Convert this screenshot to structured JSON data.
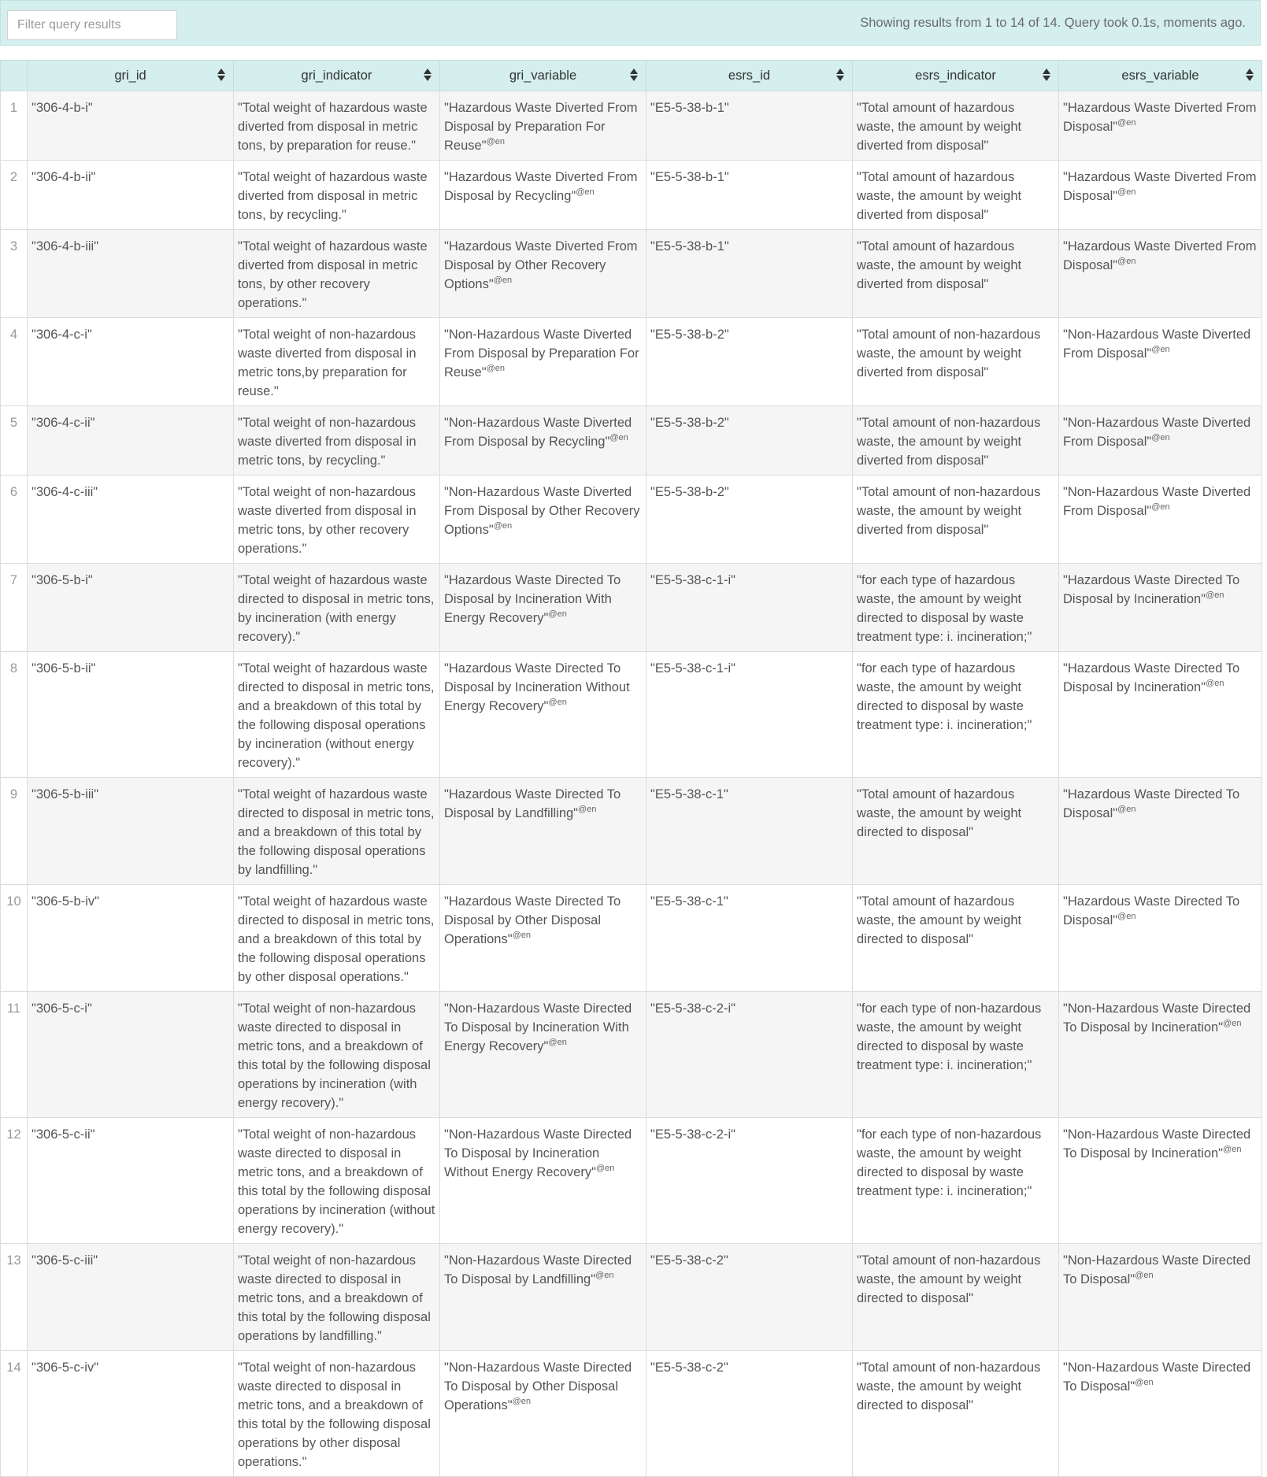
{
  "toolbar": {
    "filter_placeholder": "Filter query results",
    "status": "Showing results from 1 to 14 of 14. Query took 0.1s, moments ago."
  },
  "columns": [
    "gri_id",
    "gri_indicator",
    "gri_variable",
    "esrs_id",
    "esrs_indicator",
    "esrs_variable"
  ],
  "lang_tag": "@en",
  "rows": [
    {
      "n": "1",
      "gri_id": "\"306-4-b-i\"",
      "gri_indicator": "\"Total weight of hazardous waste diverted from disposal in metric tons, by preparation for reuse.\"",
      "gri_variable": "\"Hazardous Waste Diverted From Disposal by Preparation For Reuse\"",
      "esrs_id": "\"E5-5-38-b-1\"",
      "esrs_indicator": "\"Total amount of hazardous waste, the amount by weight diverted from disposal\"",
      "esrs_variable": "\"Hazardous Waste Diverted From Disposal\""
    },
    {
      "n": "2",
      "gri_id": "\"306-4-b-ii\"",
      "gri_indicator": "\"Total weight of hazardous waste diverted from disposal in metric tons, by recycling.\"",
      "gri_variable": "\"Hazardous Waste Diverted From Disposal by Recycling\"",
      "esrs_id": "\"E5-5-38-b-1\"",
      "esrs_indicator": "\"Total amount of hazardous waste, the amount by weight diverted from disposal\"",
      "esrs_variable": "\"Hazardous Waste Diverted From Disposal\""
    },
    {
      "n": "3",
      "gri_id": "\"306-4-b-iii\"",
      "gri_indicator": "\"Total weight of hazardous waste diverted from disposal in metric tons, by other recovery operations.\"",
      "gri_variable": "\"Hazardous Waste Diverted From Disposal by Other Recovery Options\"",
      "esrs_id": "\"E5-5-38-b-1\"",
      "esrs_indicator": "\"Total amount of hazardous waste, the amount by weight diverted from disposal\"",
      "esrs_variable": "\"Hazardous Waste Diverted From Disposal\""
    },
    {
      "n": "4",
      "gri_id": "\"306-4-c-i\"",
      "gri_indicator": "\"Total weight of non-hazardous waste diverted from disposal in metric tons,by preparation for reuse.\"",
      "gri_variable": "\"Non-Hazardous Waste Diverted From Disposal by Preparation For Reuse\"",
      "esrs_id": "\"E5-5-38-b-2\"",
      "esrs_indicator": "\"Total amount of non-hazardous waste, the amount by weight diverted from disposal\"",
      "esrs_variable": "\"Non-Hazardous Waste Diverted From Disposal\""
    },
    {
      "n": "5",
      "gri_id": "\"306-4-c-ii\"",
      "gri_indicator": "\"Total weight of non-hazardous waste diverted from disposal in metric tons, by recycling.\"",
      "gri_variable": "\"Non-Hazardous Waste Diverted From Disposal by Recycling\"",
      "esrs_id": "\"E5-5-38-b-2\"",
      "esrs_indicator": "\"Total amount of non-hazardous waste, the amount by weight diverted from disposal\"",
      "esrs_variable": "\"Non-Hazardous Waste Diverted From Disposal\""
    },
    {
      "n": "6",
      "gri_id": "\"306-4-c-iii\"",
      "gri_indicator": "\"Total weight of non-hazardous waste diverted from disposal in metric tons, by other recovery operations.\"",
      "gri_variable": "\"Non-Hazardous Waste Diverted From Disposal by Other Recovery Options\"",
      "esrs_id": "\"E5-5-38-b-2\"",
      "esrs_indicator": "\"Total amount of non-hazardous waste, the amount by weight diverted from disposal\"",
      "esrs_variable": "\"Non-Hazardous Waste Diverted From Disposal\""
    },
    {
      "n": "7",
      "gri_id": "\"306-5-b-i\"",
      "gri_indicator": "\"Total weight of hazardous waste directed to disposal in metric tons, by incineration (with energy recovery).\"",
      "gri_variable": "\"Hazardous Waste Directed To Disposal by Incineration With Energy Recovery\"",
      "esrs_id": "\"E5-5-38-c-1-i\"",
      "esrs_indicator": "\"for each type of hazardous waste, the amount by weight directed to disposal by waste treatment type: i. incineration;\"",
      "esrs_variable": "\"Hazardous Waste Directed To Disposal by Incineration\""
    },
    {
      "n": "8",
      "gri_id": "\"306-5-b-ii\"",
      "gri_indicator": "\"Total weight of hazardous waste directed to disposal in metric tons, and a breakdown of this total by the following disposal operations by incineration (without energy recovery).\"",
      "gri_variable": "\"Hazardous Waste Directed To Disposal by Incineration Without Energy Recovery\"",
      "esrs_id": "\"E5-5-38-c-1-i\"",
      "esrs_indicator": "\"for each type of hazardous waste, the amount by weight directed to disposal by waste treatment type: i. incineration;\"",
      "esrs_variable": "\"Hazardous Waste Directed To Disposal by Incineration\""
    },
    {
      "n": "9",
      "gri_id": "\"306-5-b-iii\"",
      "gri_indicator": "\"Total weight of hazardous waste directed to disposal in metric tons, and a breakdown of this total by the following disposal operations by landfilling.\"",
      "gri_variable": "\"Hazardous Waste Directed To Disposal by Landfilling\"",
      "esrs_id": "\"E5-5-38-c-1\"",
      "esrs_indicator": "\"Total amount of hazardous waste, the amount by weight directed to disposal\"",
      "esrs_variable": "\"Hazardous Waste Directed To Disposal\""
    },
    {
      "n": "10",
      "gri_id": "\"306-5-b-iv\"",
      "gri_indicator": "\"Total weight of hazardous waste directed to disposal in metric tons, and a breakdown of this total by the following disposal operations by other disposal operations.\"",
      "gri_variable": "\"Hazardous Waste Directed To Disposal by Other Disposal Operations\"",
      "esrs_id": "\"E5-5-38-c-1\"",
      "esrs_indicator": "\"Total amount of hazardous waste, the amount by weight directed to disposal\"",
      "esrs_variable": "\"Hazardous Waste Directed To Disposal\""
    },
    {
      "n": "11",
      "gri_id": "\"306-5-c-i\"",
      "gri_indicator": "\"Total weight of non-hazardous waste directed to disposal in metric tons, and a breakdown of this total by the following disposal operations by incineration (with energy recovery).\"",
      "gri_variable": "\"Non-Hazardous Waste Directed To Disposal by Incineration With Energy Recovery\"",
      "esrs_id": "\"E5-5-38-c-2-i\"",
      "esrs_indicator": "\"for each type of non-hazardous waste, the amount by weight directed to disposal by waste treatment type: i. incineration;\"",
      "esrs_variable": "\"Non-Hazardous Waste Directed To Disposal by Incineration\""
    },
    {
      "n": "12",
      "gri_id": "\"306-5-c-ii\"",
      "gri_indicator": "\"Total weight of non-hazardous waste directed to disposal in metric tons, and a breakdown of this total by the following disposal operations by incineration (without energy recovery).\"",
      "gri_variable": "\"Non-Hazardous Waste Directed To Disposal by Incineration Without Energy Recovery\"",
      "esrs_id": "\"E5-5-38-c-2-i\"",
      "esrs_indicator": "\"for each type of non-hazardous waste, the amount by weight directed to disposal by waste treatment type: i. incineration;\"",
      "esrs_variable": "\"Non-Hazardous Waste Directed To Disposal by Incineration\""
    },
    {
      "n": "13",
      "gri_id": "\"306-5-c-iii\"",
      "gri_indicator": "\"Total weight of non-hazardous waste directed to disposal in metric tons, and a breakdown of this total by the following disposal operations by landfilling.\"",
      "gri_variable": "\"Non-Hazardous Waste Directed To Disposal by Landfilling\"",
      "esrs_id": "\"E5-5-38-c-2\"",
      "esrs_indicator": "\"Total amount of non-hazardous waste, the amount by weight directed to disposal\"",
      "esrs_variable": "\"Non-Hazardous Waste Directed To Disposal\""
    },
    {
      "n": "14",
      "gri_id": "\"306-5-c-iv\"",
      "gri_indicator": "\"Total weight of non-hazardous waste directed to disposal in metric tons, and a breakdown of this total by the following disposal operations by other disposal operations.\"",
      "gri_variable": "\"Non-Hazardous Waste Directed To Disposal by Other Disposal Operations\"",
      "esrs_id": "\"E5-5-38-c-2\"",
      "esrs_indicator": "\"Total amount of non-hazardous waste, the amount by weight directed to disposal\"",
      "esrs_variable": "\"Non-Hazardous Waste Directed To Disposal\""
    }
  ]
}
